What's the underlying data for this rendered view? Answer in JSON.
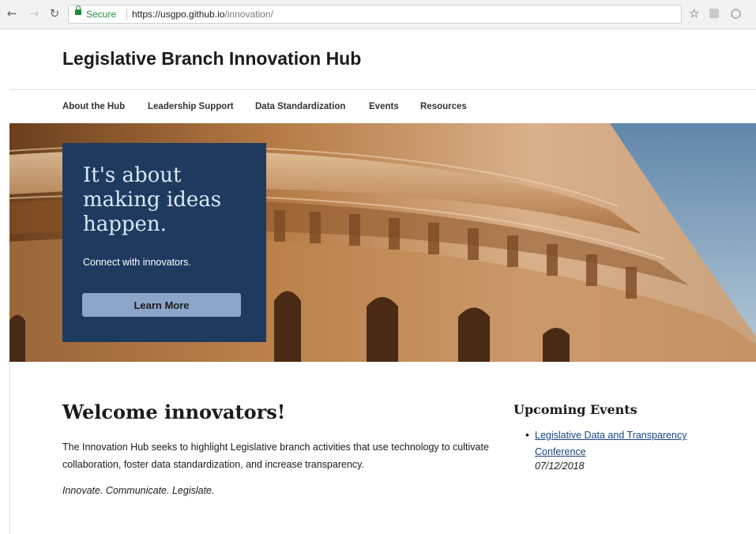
{
  "browser": {
    "secure_label": "Secure",
    "url_host": "https://usgpo.github.io",
    "url_path": "/innovation/",
    "icons": [
      "back-icon",
      "forward-icon",
      "reload-icon",
      "lock-icon",
      "star-icon",
      "extension-icon",
      "profile-icon"
    ]
  },
  "site": {
    "title": "Legislative Branch Innovation Hub"
  },
  "nav": {
    "items": [
      {
        "label": "About the Hub"
      },
      {
        "label": "Leadership Support"
      },
      {
        "label": "Data Standardization"
      },
      {
        "label": "Events"
      },
      {
        "label": "Resources"
      }
    ]
  },
  "hero": {
    "heading": "It's about making ideas happen.",
    "text": "Connect with innovators.",
    "button": "Learn More",
    "colors": {
      "callout": "#1e3a5f",
      "button": "#8ba6ca"
    }
  },
  "main": {
    "heading": "Welcome innovators!",
    "intro": "The Innovation Hub seeks to highlight Legislative branch activities that use technology to cultivate collaboration, foster data standardization, and increase transparency.",
    "motto": "Innovate. Communicate. Legislate."
  },
  "events": {
    "title": "Upcoming Events",
    "items": [
      {
        "name": "Legislative Data and Transparency Conference",
        "date": "07/12/2018"
      }
    ]
  }
}
